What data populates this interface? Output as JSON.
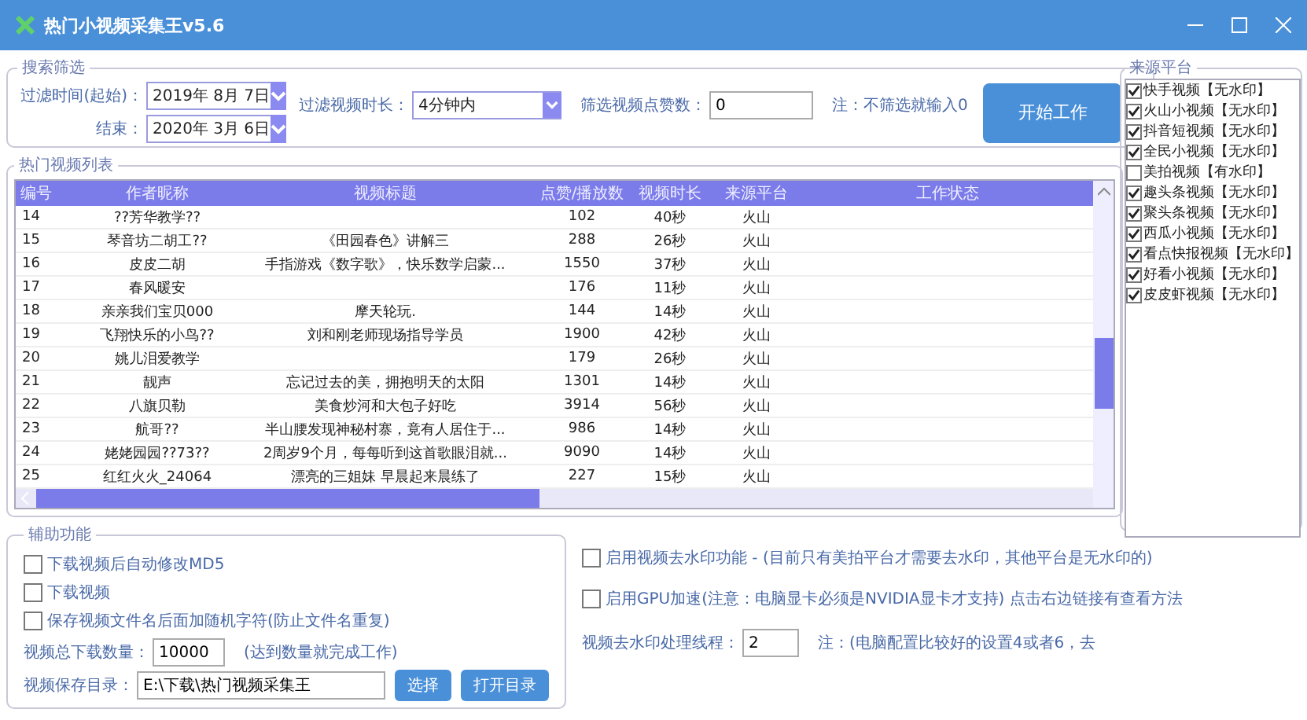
{
  "window": {
    "title": "热门小视频采集王v5.6"
  },
  "search": {
    "legend": "搜索筛选",
    "start_label": "过滤时间(起始)：",
    "start_value": "2019年  8月  7日",
    "end_label": "结束：",
    "end_value": "2020年  3月  6日",
    "duration_label": "过滤视频时长：",
    "duration_value": "4分钟内",
    "likes_label": "筛选视频点赞数：",
    "likes_value": "0",
    "likes_note": "注：不筛选就输入0",
    "start_button": "开始工作"
  },
  "platforms": {
    "legend": "来源平台",
    "items": [
      {
        "label": "快手视频【无水印】",
        "checked": true
      },
      {
        "label": "火山小视频【无水印】",
        "checked": true
      },
      {
        "label": "抖音短视频【无水印】",
        "checked": true
      },
      {
        "label": "全民小视频【无水印】",
        "checked": true
      },
      {
        "label": "美拍视频【有水印】",
        "checked": false
      },
      {
        "label": "趣头条视频【无水印】",
        "checked": true
      },
      {
        "label": "聚头条视频【无水印】",
        "checked": true
      },
      {
        "label": "西瓜小视频【无水印】",
        "checked": true
      },
      {
        "label": "看点快报视频【无水印】",
        "checked": true
      },
      {
        "label": "好看小视频【无水印】",
        "checked": true
      },
      {
        "label": "皮皮虾视频【无水印】",
        "checked": true
      }
    ]
  },
  "table": {
    "legend": "热门视频列表",
    "columns": [
      "编号",
      "作者昵称",
      "视频标题",
      "点赞/播放数",
      "视频时长",
      "来源平台",
      "工作状态"
    ],
    "rows": [
      [
        "14",
        "??芳华教学??",
        "",
        "102",
        "40秒",
        "火山",
        ""
      ],
      [
        "15",
        "琴音坊二胡工??",
        "《田园春色》讲解三",
        "288",
        "26秒",
        "火山",
        ""
      ],
      [
        "16",
        "皮皮二胡",
        "手指游戏《数字歌》，快乐数学启蒙...",
        "1550",
        "37秒",
        "火山",
        ""
      ],
      [
        "17",
        "春风暖安",
        "",
        "176",
        "11秒",
        "火山",
        ""
      ],
      [
        "18",
        "亲亲我们宝贝000",
        "摩天轮玩.",
        "144",
        "14秒",
        "火山",
        ""
      ],
      [
        "19",
        "飞翔快乐的小鸟??",
        "刘和刚老师现场指导学员",
        "1900",
        "42秒",
        "火山",
        ""
      ],
      [
        "20",
        "姚儿泪爱教学",
        "",
        "179",
        "26秒",
        "火山",
        ""
      ],
      [
        "21",
        "靓声",
        "忘记过去的美，拥抱明天的太阳",
        "1301",
        "14秒",
        "火山",
        ""
      ],
      [
        "22",
        "八旗贝勒",
        "美食炒河和大包子好吃",
        "3914",
        "56秒",
        "火山",
        ""
      ],
      [
        "23",
        "航哥??",
        "半山腰发现神秘村寨，竟有人居住于...",
        "986",
        "14秒",
        "火山",
        ""
      ],
      [
        "24",
        "姥姥园园??73??",
        "2周岁9个月，每每听到这首歌眼泪就...",
        "9090",
        "14秒",
        "火山",
        ""
      ],
      [
        "25",
        "红红火火_24064",
        "漂亮的三姐妹 早晨起来晨练了",
        "227",
        "15秒",
        "火山",
        ""
      ]
    ]
  },
  "aux": {
    "legend": "辅助功能",
    "options": [
      {
        "label": "下载视频后自动修改MD5",
        "checked": false
      },
      {
        "label": "下载视频",
        "checked": false
      },
      {
        "label": "保存视频文件名后面加随机字符(防止文件名重复)",
        "checked": false
      }
    ],
    "count_label": "视频总下载数量：",
    "count_value": "10000",
    "count_note": "(达到数量就完成工作)",
    "dir_label": "视频保存目录：",
    "dir_value": "E:\\下载\\热门视频采集王",
    "choose_button": "选择",
    "open_button": "打开目录"
  },
  "watermark_options": [
    {
      "label": "启用视频去水印功能 - (目前只有美拍平台才需要去水印，其他平台是无水印的)",
      "checked": false
    },
    {
      "label": "启用GPU加速(注意：电脑显卡必须是NVIDIA显卡才支持) 点击右边链接有查看方法",
      "checked": false
    }
  ],
  "threads": {
    "label": "视频去水印处理线程：",
    "value": "2",
    "note": "注：(电脑配置比较好的设置4或者6，去"
  }
}
